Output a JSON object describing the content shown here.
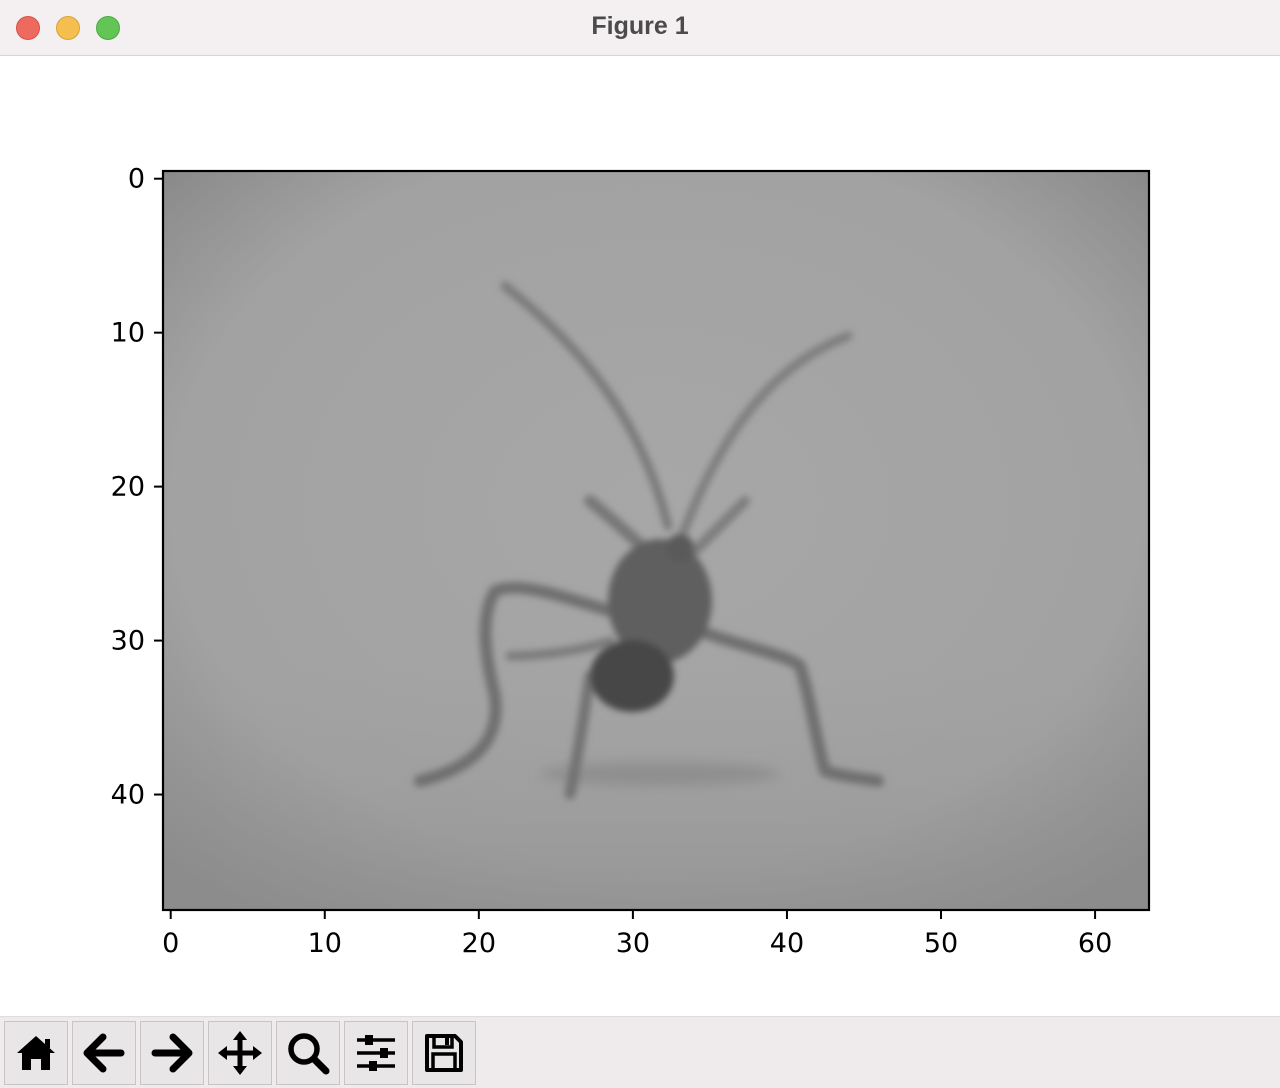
{
  "window": {
    "title": "Figure 1"
  },
  "toolbar": {
    "buttons": [
      {
        "name": "home",
        "icon": "home-icon"
      },
      {
        "name": "back",
        "icon": "arrow-left-icon"
      },
      {
        "name": "forward",
        "icon": "arrow-right-icon"
      },
      {
        "name": "pan",
        "icon": "move-icon"
      },
      {
        "name": "zoom",
        "icon": "magnifier-icon"
      },
      {
        "name": "configure-subplots",
        "icon": "sliders-icon"
      },
      {
        "name": "save",
        "icon": "floppy-disk-icon"
      }
    ]
  },
  "chart_data": {
    "type": "image",
    "title": "",
    "xlabel": "",
    "ylabel": "",
    "xlim": [
      -0.5,
      63.5
    ],
    "ylim": [
      47.5,
      -0.5
    ],
    "x_ticks": [
      0,
      10,
      20,
      30,
      40,
      50,
      60
    ],
    "x_tick_labels": [
      "0",
      "10",
      "20",
      "30",
      "40",
      "50",
      "60"
    ],
    "y_ticks": [
      0,
      10,
      20,
      30,
      40
    ],
    "y_tick_labels": [
      "0",
      "10",
      "20",
      "30",
      "40"
    ],
    "image_size": [
      64,
      48
    ],
    "colormap": "gray",
    "content": "blurred grayscale photo of an insect",
    "grid": false
  }
}
